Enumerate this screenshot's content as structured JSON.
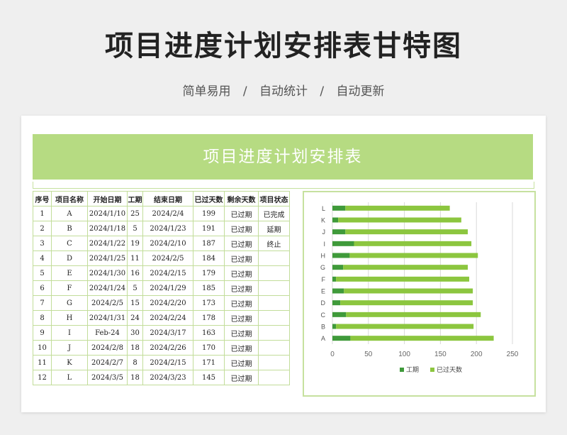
{
  "page": {
    "title": "项目进度计划安排表甘特图",
    "subtitle": [
      "简单易用",
      "自动统计",
      "自动更新"
    ],
    "separator": "/"
  },
  "sheet": {
    "banner": "项目进度计划安排表",
    "headers": [
      "序号",
      "项目名称",
      "开始日期",
      "工期",
      "结束日期",
      "已过天数",
      "剩余天数",
      "项目状态"
    ],
    "rows": [
      [
        "1",
        "A",
        "2024/1/10",
        "25",
        "2024/2/4",
        "199",
        "已过期",
        "已完成"
      ],
      [
        "2",
        "B",
        "2024/1/18",
        "5",
        "2024/1/23",
        "191",
        "已过期",
        "延期"
      ],
      [
        "3",
        "C",
        "2024/1/22",
        "19",
        "2024/2/10",
        "187",
        "已过期",
        "终止"
      ],
      [
        "4",
        "D",
        "2024/1/25",
        "11",
        "2024/2/5",
        "184",
        "已过期",
        ""
      ],
      [
        "5",
        "E",
        "2024/1/30",
        "16",
        "2024/2/15",
        "179",
        "已过期",
        ""
      ],
      [
        "6",
        "F",
        "2024/1/24",
        "5",
        "2024/1/29",
        "185",
        "已过期",
        ""
      ],
      [
        "7",
        "G",
        "2024/2/5",
        "15",
        "2024/2/20",
        "173",
        "已过期",
        ""
      ],
      [
        "8",
        "H",
        "2024/1/31",
        "24",
        "2024/2/24",
        "178",
        "已过期",
        ""
      ],
      [
        "9",
        "I",
        "Feb-24",
        "30",
        "2024/3/17",
        "163",
        "已过期",
        ""
      ],
      [
        "10",
        "J",
        "2024/2/8",
        "18",
        "2024/2/26",
        "170",
        "已过期",
        ""
      ],
      [
        "11",
        "K",
        "2024/2/7",
        "8",
        "2024/2/15",
        "171",
        "已过期",
        ""
      ],
      [
        "12",
        "L",
        "2024/3/5",
        "18",
        "2024/3/23",
        "145",
        "已过期",
        ""
      ]
    ]
  },
  "chart_data": {
    "type": "bar",
    "orientation": "horizontal",
    "stacked": true,
    "categories": [
      "A",
      "B",
      "C",
      "D",
      "E",
      "F",
      "G",
      "H",
      "I",
      "J",
      "K",
      "L"
    ],
    "series": [
      {
        "name": "工期",
        "values": [
          25,
          5,
          19,
          11,
          16,
          5,
          15,
          24,
          30,
          18,
          8,
          18
        ],
        "color": "#3f9a3a"
      },
      {
        "name": "已过天数",
        "values": [
          199,
          191,
          187,
          184,
          179,
          185,
          173,
          178,
          163,
          170,
          171,
          145
        ],
        "color": "#8cc63f"
      }
    ],
    "xlim": [
      0,
      250
    ],
    "xticks": [
      0,
      50,
      100,
      150,
      200,
      250
    ],
    "grid": true,
    "legend": "bottom"
  }
}
